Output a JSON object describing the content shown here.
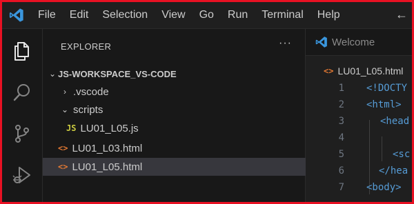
{
  "menubar": {
    "items": [
      "File",
      "Edit",
      "Selection",
      "View",
      "Go",
      "Run",
      "Terminal",
      "Help"
    ],
    "back_glyph": "←"
  },
  "activity_bar": {
    "icons": [
      "explorer-files-icon",
      "search-icon",
      "source-control-icon",
      "run-debug-icon"
    ]
  },
  "explorer": {
    "title": "EXPLORER",
    "more": "···",
    "root": "JS-WORKSPACE_VS-CODE",
    "items": [
      {
        "label": ".vscode",
        "kind": "folder",
        "expanded": false
      },
      {
        "label": "scripts",
        "kind": "folder",
        "expanded": true
      },
      {
        "label": "LU01_L05.js",
        "kind": "js",
        "icon": "JS"
      },
      {
        "label": "LU01_L03.html",
        "kind": "html",
        "icon": "<>"
      },
      {
        "label": "LU01_L05.html",
        "kind": "html",
        "icon": "<>",
        "selected": true
      }
    ]
  },
  "editor": {
    "tab": "Welcome",
    "breadcrumb": "LU01_L05.html",
    "lines": [
      {
        "n": "1",
        "code": "<!DOCTY"
      },
      {
        "n": "2",
        "code": "<html>"
      },
      {
        "n": "3",
        "code": "<head"
      },
      {
        "n": "4",
        "code": ""
      },
      {
        "n": "5",
        "code": "<sc"
      },
      {
        "n": "6",
        "code": "</hea"
      },
      {
        "n": "7",
        "code": "<body>"
      }
    ]
  },
  "colors": {
    "accent_blue": "#3a96dd",
    "html_icon": "#e37933",
    "js_icon": "#cbcb41",
    "border_red": "#e81123"
  }
}
